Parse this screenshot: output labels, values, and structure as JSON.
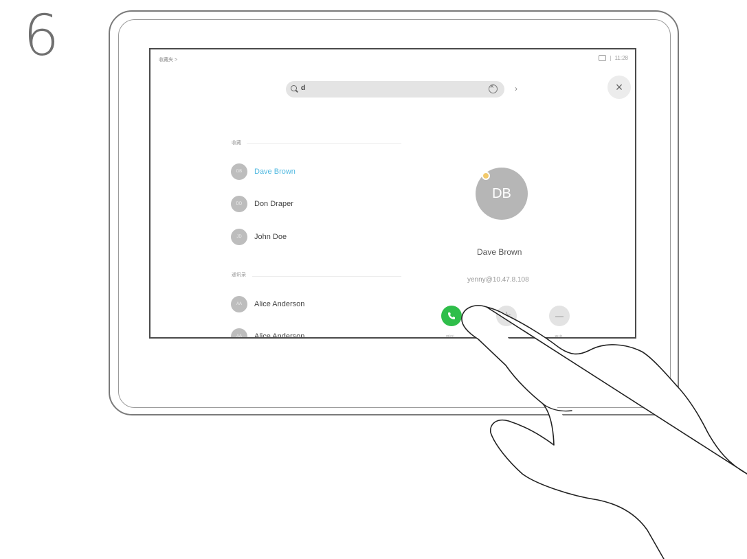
{
  "step": "6",
  "status": {
    "left": "收藏夹 >",
    "time": "11:28"
  },
  "search": {
    "query": "d"
  },
  "sections": {
    "favorites": "收藏",
    "directory": "通讯录"
  },
  "contacts": [
    {
      "initials": "DB",
      "name": "Dave Brown",
      "active": true
    },
    {
      "initials": "DD",
      "name": "Don Draper",
      "active": false
    },
    {
      "initials": "JD",
      "name": "John Doe",
      "active": false
    },
    {
      "initials": "AA",
      "name": "Alice Anderson",
      "active": false
    },
    {
      "initials": "AA",
      "name": "Alice Anderson",
      "active": false
    }
  ],
  "detail": {
    "initials": "DB",
    "name": "Dave Brown",
    "address": "yenny@10.47.8.108"
  },
  "actions": {
    "call_label": "呼叫",
    "more_label": "更多"
  },
  "colors": {
    "accent": "#4fb8e0",
    "call_green": "#2fbe4a",
    "presence": "#f2c96b"
  }
}
